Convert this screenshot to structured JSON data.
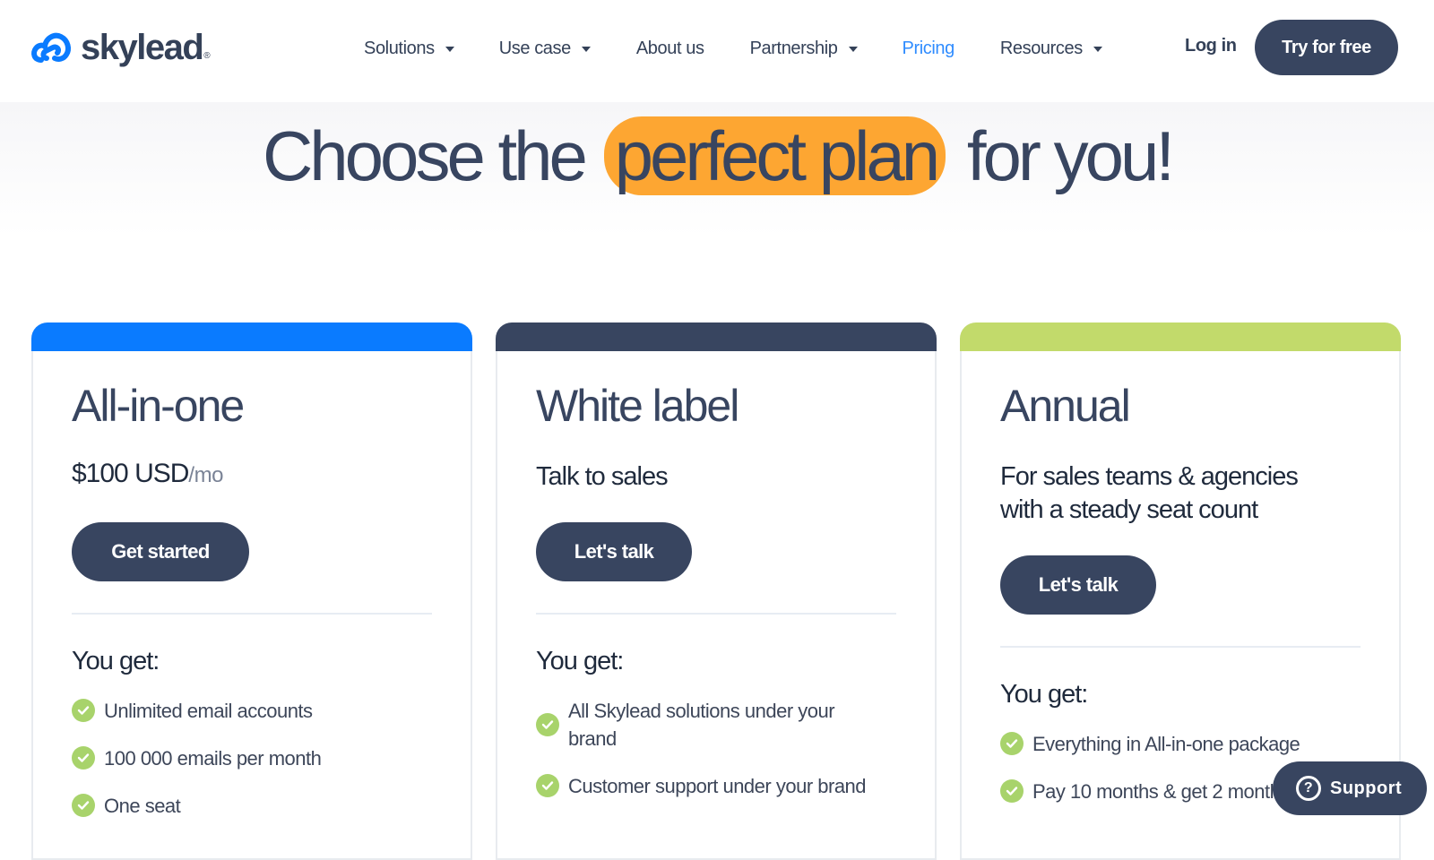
{
  "brand": {
    "name": "skylead",
    "registered": "®",
    "logo_icon": "cloud-link-icon",
    "colors": {
      "navy": "#384560",
      "blue": "#0a7bff",
      "orange": "#fda632",
      "green": "#c2da6b",
      "check": "#a8d36b"
    }
  },
  "nav": {
    "items": [
      {
        "label": "Solutions",
        "dropdown": true
      },
      {
        "label": "Use case",
        "dropdown": true
      },
      {
        "label": "About us",
        "dropdown": false
      },
      {
        "label": "Partnership",
        "dropdown": true
      },
      {
        "label": "Pricing",
        "dropdown": false,
        "active": true
      },
      {
        "label": "Resources",
        "dropdown": true
      }
    ],
    "login": "Log in",
    "cta": "Try for free"
  },
  "hero": {
    "before": "Choose the",
    "highlight": "perfect plan",
    "after": "for you!"
  },
  "plans": [
    {
      "title": "All-in-one",
      "price": "$100 USD",
      "per": "/mo",
      "button": "Get started",
      "you_get": "You get:",
      "features": [
        "Unlimited email accounts",
        "100 000 emails per month",
        "One seat"
      ]
    },
    {
      "title": "White label",
      "subtitle": "Talk to sales",
      "button": "Let's talk",
      "you_get": "You get:",
      "features": [
        "All Skylead solutions under your brand",
        "Customer support under your brand"
      ]
    },
    {
      "title": "Annual",
      "subtitle": "For sales teams & agencies with a steady seat count",
      "button": "Let's talk",
      "you_get": "You get:",
      "features": [
        "Everything in All-in-one package",
        "Pay 10 months & get 2 months"
      ]
    }
  ],
  "support": {
    "label": "Support",
    "icon": "question-circle-icon",
    "glyph": "?"
  }
}
